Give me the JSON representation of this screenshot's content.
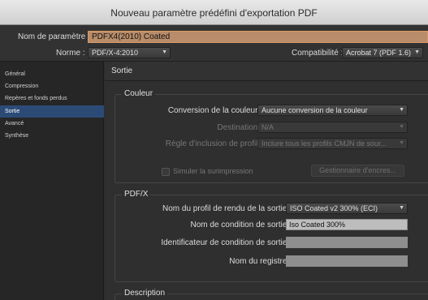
{
  "window": {
    "title": "Nouveau paramètre prédéfini d'exportation PDF"
  },
  "top": {
    "preset_label": "Nom de paramètre :",
    "preset_value": "PDFX4(2010) Coated",
    "standard_label": "Norme :",
    "standard_value": "PDF/X-4:2010",
    "compat_label": "Compatibilité :",
    "compat_value": "Acrobat 7 (PDF 1.6)"
  },
  "sidebar": {
    "items": [
      {
        "label": "Général"
      },
      {
        "label": "Compression"
      },
      {
        "label": "Repères et fonds perdus"
      },
      {
        "label": "Sortie"
      },
      {
        "label": "Avancé"
      },
      {
        "label": "Synthèse"
      }
    ],
    "selected_index": 3
  },
  "main": {
    "section_title": "Sortie",
    "couleur": {
      "title": "Couleur",
      "conversion_label": "Conversion de la couleur :",
      "conversion_value": "Aucune conversion de la couleur",
      "destination_label": "Destination :",
      "destination_value": "N/A",
      "profile_label": "Règle d'inclusion de profil :",
      "profile_value": "Inclure tous les profils CMJN de sour...",
      "simulate_label": "Simuler la surimpression",
      "ink_button": "Gestionnaire d'encres..."
    },
    "pdfx": {
      "title": "PDF/X",
      "profile_label": "Nom du profil de rendu de la sortie :",
      "profile_value": "ISO Coated v2 300% (ECI)",
      "condition_label": "Nom de condition de sortie :",
      "condition_value": "Iso Coated 300%",
      "identifier_label": "Identificateur de condition de sortie :",
      "identifier_value": "",
      "registry_label": "Nom du registre :",
      "registry_value": ""
    },
    "description": {
      "title": "Description"
    }
  }
}
